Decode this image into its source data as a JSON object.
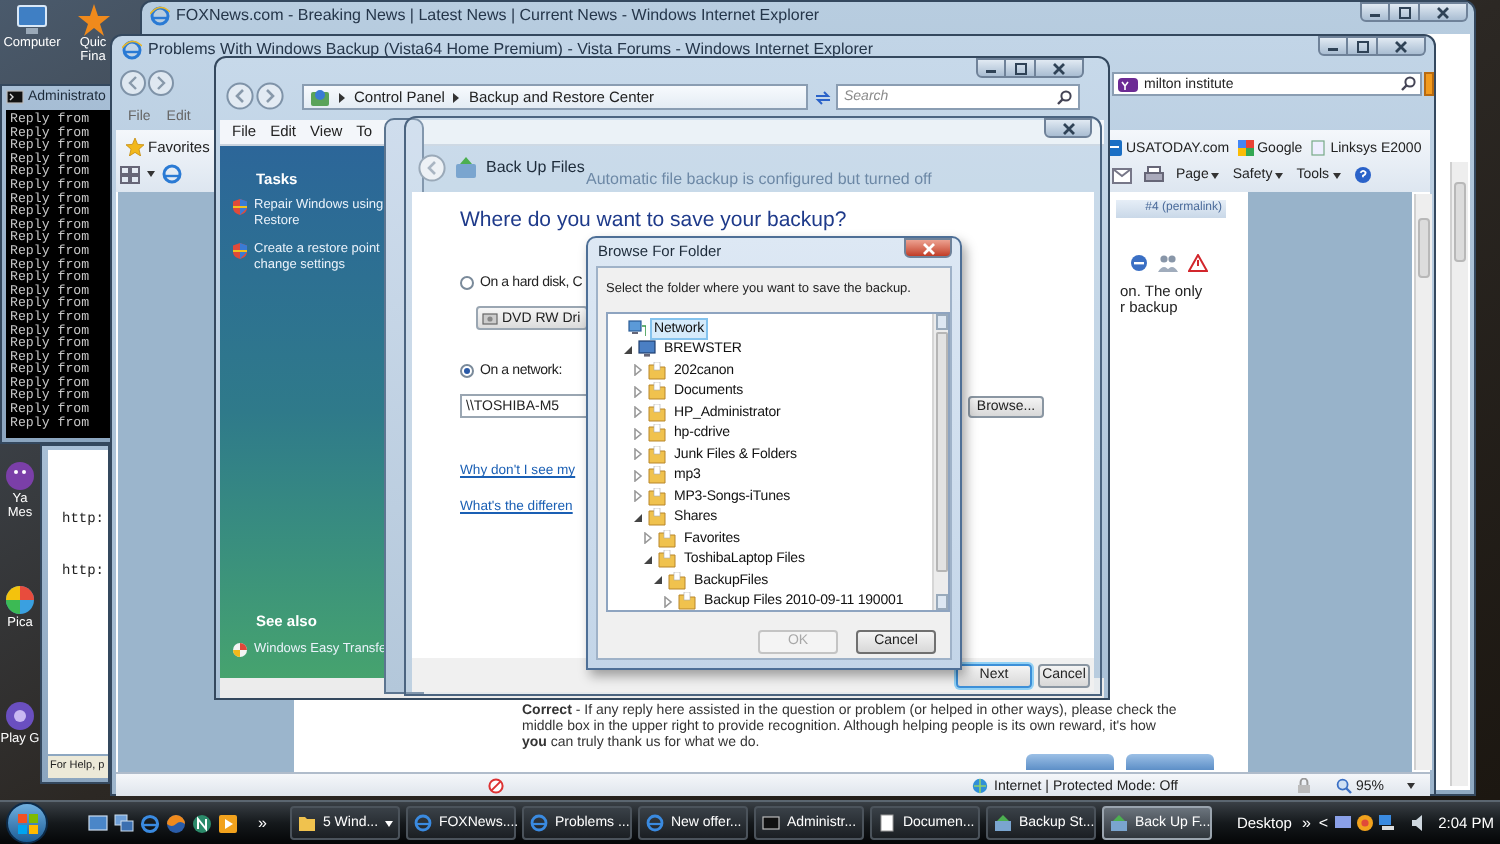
{
  "desktop_icons": [
    {
      "kind": "computer",
      "lines": [
        "Computer"
      ]
    },
    {
      "kind": "star",
      "lines": [
        "Quic",
        "Fina"
      ]
    },
    {
      "kind": "smiley",
      "lines": [
        "Ya",
        "Mes"
      ]
    },
    {
      "kind": "pinwheel",
      "lines": [
        "Pica"
      ]
    },
    {
      "kind": "game",
      "lines": [
        "Play G"
      ]
    }
  ],
  "background_window": {
    "title": "FOXNews.com - Breaking News | Latest News | Current News - Windows Internet Explorer"
  },
  "console_window": {
    "title": "Administrato",
    "lines": [
      "Reply from",
      "Reply from",
      "Reply from",
      "Reply from",
      "Reply from",
      "Reply from",
      "Reply from",
      "Reply from",
      "Reply from",
      "Reply from",
      "Reply from",
      "Reply from",
      "Reply from",
      "Reply from",
      "Reply from",
      "Reply from",
      "Reply from",
      "Reply from",
      "Reply from",
      "Reply from",
      "Reply from",
      "Reply from",
      "Reply from",
      "Reply from"
    ]
  },
  "document_window": {
    "lines": [
      "http:",
      "http:"
    ],
    "status": "For Help, p"
  },
  "forum_window": {
    "title": "Problems With Windows Backup (Vista64 Home Premium) - Vista Forums - Windows Internet Explorer",
    "search": {
      "value": "milton institute"
    },
    "menu": [
      "File",
      "Edit"
    ],
    "favorites": "Favorites",
    "links": [
      "USATODAY.com",
      "Google",
      "Linksys E2000"
    ],
    "commands": [
      "Page",
      "Safety",
      "Tools"
    ],
    "post_link": "#4 (permalink)",
    "post_text": [
      "on. The only",
      "r backup"
    ],
    "footer_note": "**Correct** - If any reply here assisted in the question or problem (or helped in other ways), please check the middle box in the upper right to provide recognition. Although helping people is its own reward, it's how **you** can truly thank us for what we do.",
    "status": "Internet | Protected Mode: Off",
    "zoom": "95%"
  },
  "control_panel": {
    "breadcrumb": [
      "Control Panel",
      "Backup and Restore Center"
    ],
    "search": {
      "placeholder": "Search"
    },
    "menu": [
      "File",
      "Edit",
      "View",
      "To"
    ],
    "tasks_heading": "Tasks",
    "tasks": [
      {
        "lines": [
          "Repair Windows using",
          "Restore"
        ]
      },
      {
        "lines": [
          "Create a restore point",
          "change settings"
        ]
      }
    ],
    "see_also_heading": "See also",
    "see_also": [
      "Windows Easy Transfe"
    ],
    "status_text": "Automatic file backup is configured but turned off"
  },
  "wizard": {
    "title": "Back Up Files",
    "heading": "Where do you want to save your backup?",
    "options": [
      {
        "label": "On a hard disk, C",
        "selected": false
      },
      {
        "label": "On a network:",
        "selected": true
      }
    ],
    "drive_dropdown": "DVD RW Dri",
    "network_path": {
      "value": "\\\\TOSHIBA-M5"
    },
    "browse_button": "Browse...",
    "links": [
      "Why don't I see my",
      "What's the differen"
    ],
    "buttons": [
      {
        "label": "Next",
        "default": true
      },
      {
        "label": "Cancel",
        "default": false
      }
    ]
  },
  "browse_dialog": {
    "title": "Browse For Folder",
    "instruction": "Select the folder where you want to save the backup.",
    "tree": [
      {
        "label": "Network",
        "kind": "network",
        "selected": true,
        "children": [
          {
            "label": "BREWSTER",
            "kind": "computer",
            "selected": false,
            "expanded": true,
            "children": [
              {
                "label": "202canon",
                "kind": "folder",
                "selected": false,
                "expanded": false
              },
              {
                "label": "Documents",
                "kind": "folder",
                "selected": false,
                "expanded": false
              },
              {
                "label": "HP_Administrator",
                "kind": "folder",
                "selected": false,
                "expanded": false
              },
              {
                "label": "hp-cdrive",
                "kind": "folder",
                "selected": false,
                "expanded": false
              },
              {
                "label": "Junk Files & Folders",
                "kind": "folder",
                "selected": false,
                "expanded": false
              },
              {
                "label": "mp3",
                "kind": "folder",
                "selected": false,
                "expanded": false
              },
              {
                "label": "MP3-Songs-iTunes",
                "kind": "folder",
                "selected": false,
                "expanded": false
              },
              {
                "label": "Shares",
                "kind": "folder",
                "selected": false,
                "expanded": true,
                "children": [
                  {
                    "label": "Favorites",
                    "kind": "folder",
                    "selected": false,
                    "expanded": false
                  },
                  {
                    "label": "ToshibaLaptop Files",
                    "kind": "folder",
                    "selected": false,
                    "expanded": true,
                    "children": [
                      {
                        "label": "BackupFiles",
                        "kind": "folder",
                        "selected": false,
                        "expanded": true,
                        "children": [
                          {
                            "label": "Backup Files 2010-09-11 190001",
                            "kind": "folder",
                            "selected": false,
                            "expanded": false
                          }
                        ]
                      }
                    ]
                  }
                ]
              }
            ]
          }
        ]
      }
    ],
    "buttons": [
      {
        "label": "OK",
        "disabled": true
      },
      {
        "label": "Cancel",
        "disabled": false
      }
    ]
  },
  "taskbar": {
    "quick_launch_more": "»",
    "tasks": [
      {
        "label": "5 Wind...",
        "kind": "folder",
        "grouped": true,
        "selected": false
      },
      {
        "label": "FOXNews....",
        "kind": "browser",
        "grouped": false,
        "selected": false
      },
      {
        "label": "Problems ...",
        "kind": "browser",
        "grouped": false,
        "selected": false
      },
      {
        "label": "New offer...",
        "kind": "browser",
        "grouped": false,
        "selected": false
      },
      {
        "label": "Administr...",
        "kind": "console",
        "grouped": false,
        "selected": false
      },
      {
        "label": "Documen...",
        "kind": "document",
        "grouped": false,
        "selected": false
      },
      {
        "label": "Backup St...",
        "kind": "backup",
        "grouped": false,
        "selected": false
      },
      {
        "label": "Back Up F...",
        "kind": "backup",
        "grouped": false,
        "selected": true
      }
    ],
    "toolbar_label": "Desktop",
    "toolbar_more": "»",
    "tray_expand": "<",
    "clock": "2:04 PM"
  }
}
